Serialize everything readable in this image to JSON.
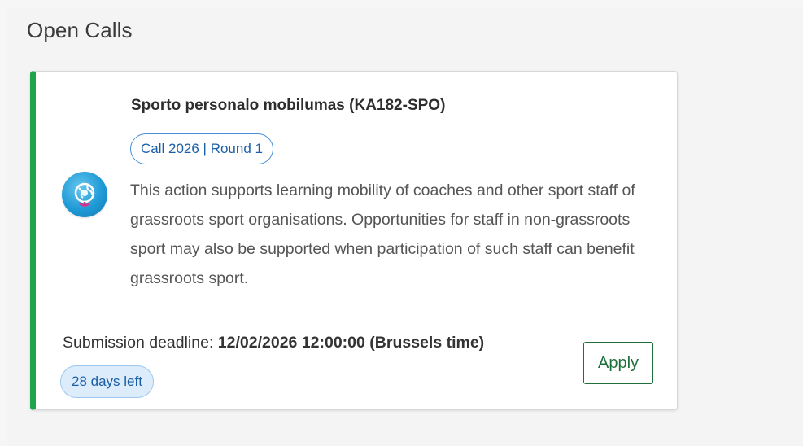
{
  "page": {
    "heading": "Open Calls"
  },
  "call_card": {
    "accent_color": "#1fa44a",
    "icon": "globe-icon",
    "title": "Sporto personalo mobilumas (KA182-SPO)",
    "call_badge": "Call 2026 | Round 1",
    "description": "This action supports learning mobility of coaches and other sport staff of grassroots sport organisations. Opportunities for staff in non-grassroots sport may also be supported when participation of such staff can benefit grassroots sport.",
    "deadline_label": "Submission deadline: ",
    "deadline_value": "12/02/2026 12:00:00 (Brussels time)",
    "days_left": "28 days left",
    "apply_label": "Apply"
  }
}
